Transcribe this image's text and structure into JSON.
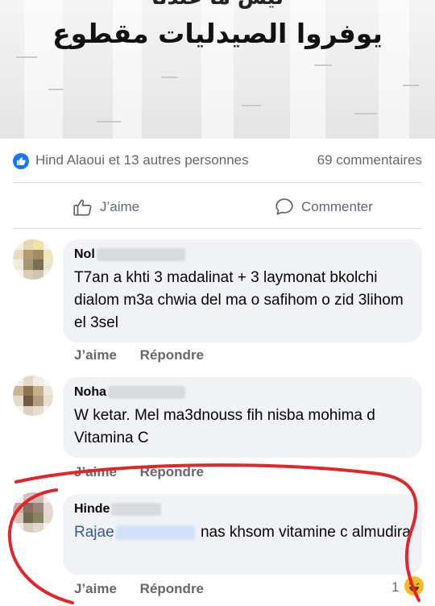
{
  "banner": {
    "top_text_partial": "ليش ما عندنا",
    "headline": "يوفروا الصيدليات مقطوع"
  },
  "reactions": {
    "like_icon": "thumbs-up-icon",
    "summary": "Hind Alaoui et 13 autres personnes",
    "comment_count": "69 commentaires"
  },
  "actions": {
    "like_label": "J’aime",
    "comment_label": "Commenter"
  },
  "comments": [
    {
      "author_visible": "Nol",
      "text": "T7an a khti 3 madalinat + 3 laymonat bkolchi dialom m3a chwia del ma o safihom o zid 3lihom el 3sel",
      "like_label": "J’aime",
      "reply_label": "Répondre"
    },
    {
      "author_visible": "Noha",
      "text": "W ketar. Mel ma3dnouss fih nisba mohima d Vitamina C",
      "like_label": "J’aime",
      "reply_label": "Répondre"
    },
    {
      "author_visible": "Hinde",
      "mention_visible": "Rajae",
      "text": "nas khsom vitamine c almudira",
      "like_label": "J’aime",
      "reply_label": "Répondre",
      "reaction_count": "1",
      "reaction_icon": "laugh-emoji-icon"
    }
  ],
  "colors": {
    "facebook_blue": "#1877f2",
    "bubble_bg": "#f0f2f5",
    "muted_text": "#65676b",
    "annotation_red": "#e0262a"
  }
}
